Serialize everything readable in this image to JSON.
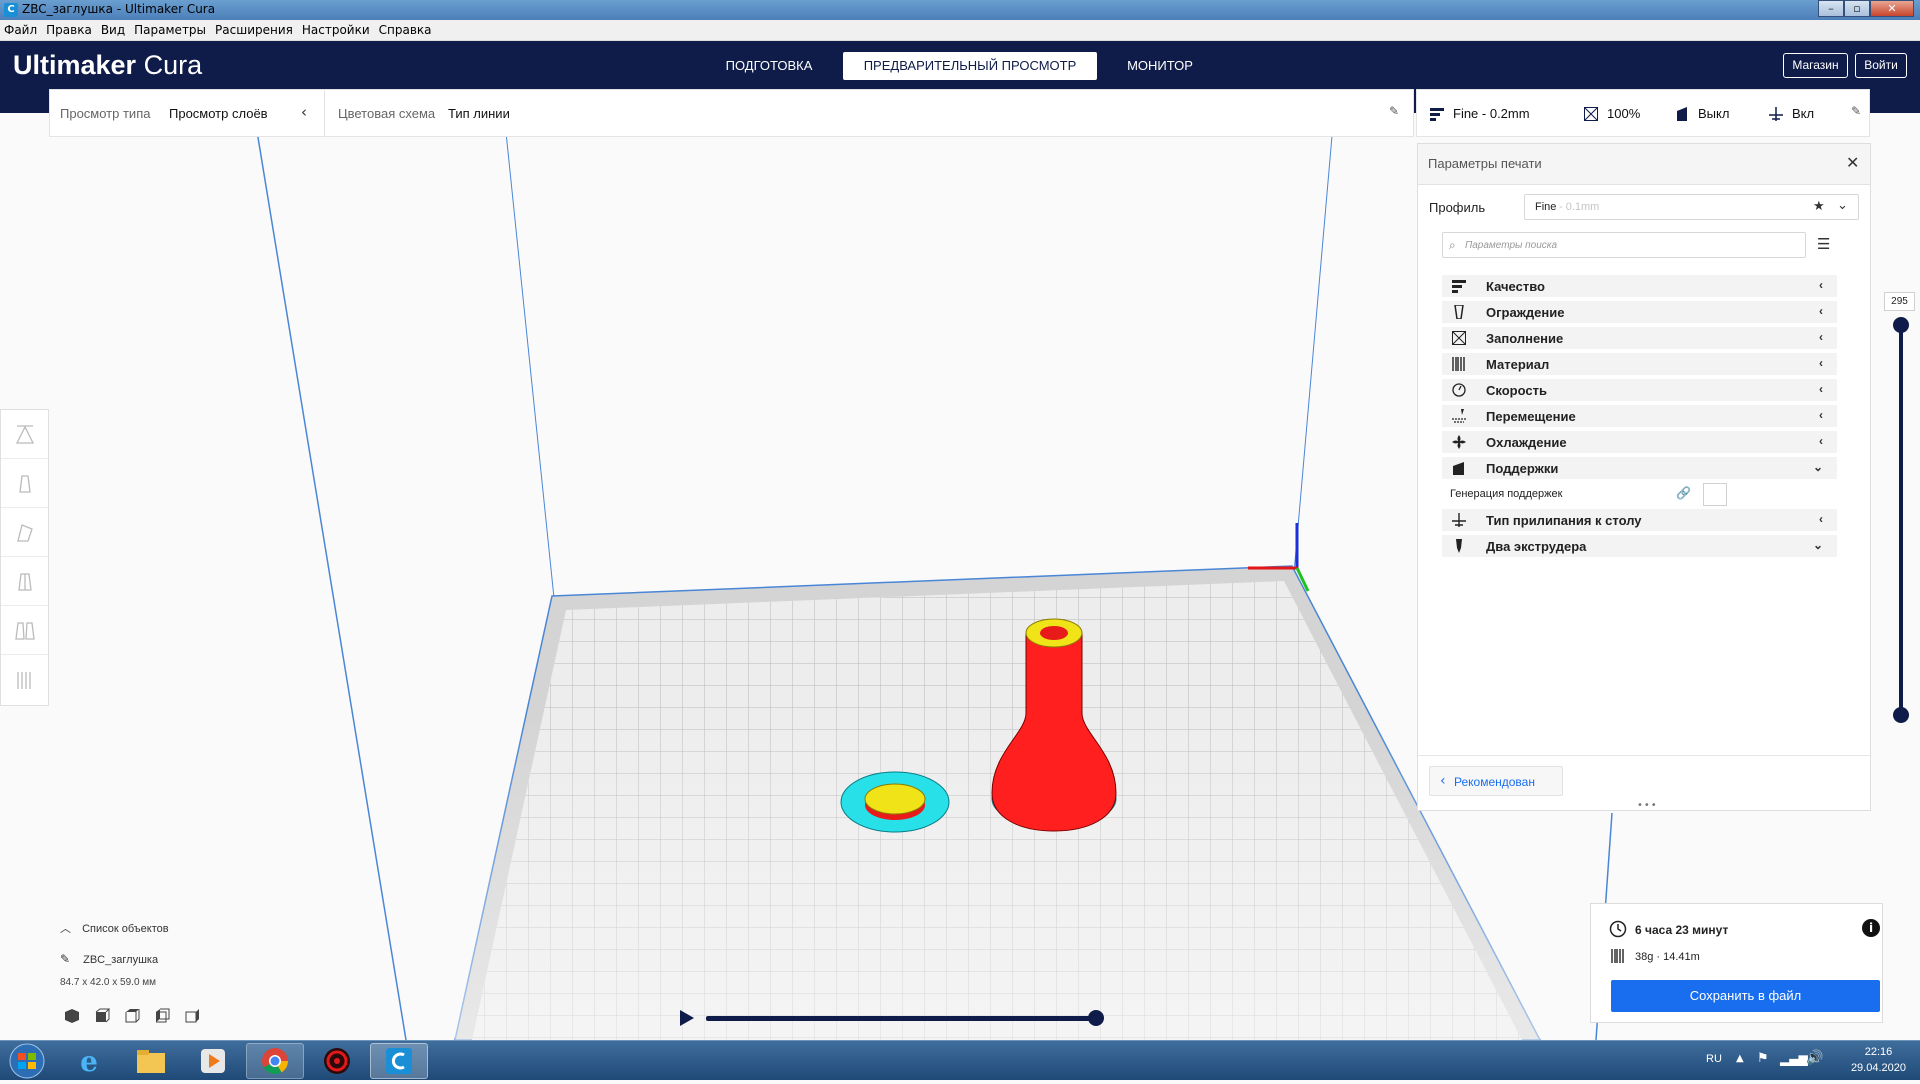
{
  "window": {
    "title": "ZBC_заглушка - Ultimaker Cura"
  },
  "menubar": {
    "items": [
      "Файл",
      "Правка",
      "Вид",
      "Параметры",
      "Расширения",
      "Настройки",
      "Справка"
    ]
  },
  "header": {
    "logo_bold": "Ultimaker",
    "logo_light": "Cura",
    "stages": [
      "ПОДГОТОВКА",
      "ПРЕДВАРИТЕЛЬНЫЙ ПРОСМОТР",
      "МОНИТОР"
    ],
    "active_stage": 1,
    "marketplace": "Магазин",
    "signin": "Войти"
  },
  "viewbar": {
    "view_type_label": "Просмотр типа",
    "view_type_value": "Просмотр слоёв",
    "color_scheme_label": "Цветовая схема",
    "color_scheme_value": "Тип линии"
  },
  "psbar": {
    "profile": "Fine - 0.2mm",
    "infill": "100%",
    "support": "Выкл",
    "adhesion": "Вкл"
  },
  "panel": {
    "title": "Параметры печати",
    "profile_label": "Профиль",
    "profile_name": "Fine",
    "profile_detail": " - 0.1mm",
    "search_placeholder": "Параметры поиска",
    "categories": [
      {
        "label": "Качество",
        "icon": "quality-icon",
        "expanded": false
      },
      {
        "label": "Ограждение",
        "icon": "shell-icon",
        "expanded": false
      },
      {
        "label": "Заполнение",
        "icon": "infill-icon",
        "expanded": false
      },
      {
        "label": "Материал",
        "icon": "material-icon",
        "expanded": false
      },
      {
        "label": "Скорость",
        "icon": "speed-icon",
        "expanded": false
      },
      {
        "label": "Перемещение",
        "icon": "travel-icon",
        "expanded": false
      },
      {
        "label": "Охлаждение",
        "icon": "cooling-icon",
        "expanded": false
      },
      {
        "label": "Поддержки",
        "icon": "support-icon",
        "expanded": true
      },
      {
        "label": "Тип прилипания к столу",
        "icon": "adhesion-icon",
        "expanded": false
      },
      {
        "label": "Два экструдера",
        "icon": "dual-icon",
        "expanded": true
      }
    ],
    "support_setting_label": "Генерация поддержек",
    "recommended": "Рекомендован"
  },
  "layer_slider": {
    "value": "295"
  },
  "estimate": {
    "time": "6 часа 23 минут",
    "material": "38g · 14.41m",
    "save": "Сохранить в файл"
  },
  "objects": {
    "header": "Список объектов",
    "name": "ZBC_заглушка",
    "dims": "84.7 x 42.0 x 59.0 мм"
  },
  "taskbar": {
    "lang": "RU",
    "time": "22:16",
    "date": "29.04.2020"
  },
  "colors": {
    "header_bg": "#0f1c4a",
    "accent": "#196ef0",
    "wall": "#ff1f1f",
    "top_skin": "#f0e318",
    "skirt": "#28e0e8"
  }
}
